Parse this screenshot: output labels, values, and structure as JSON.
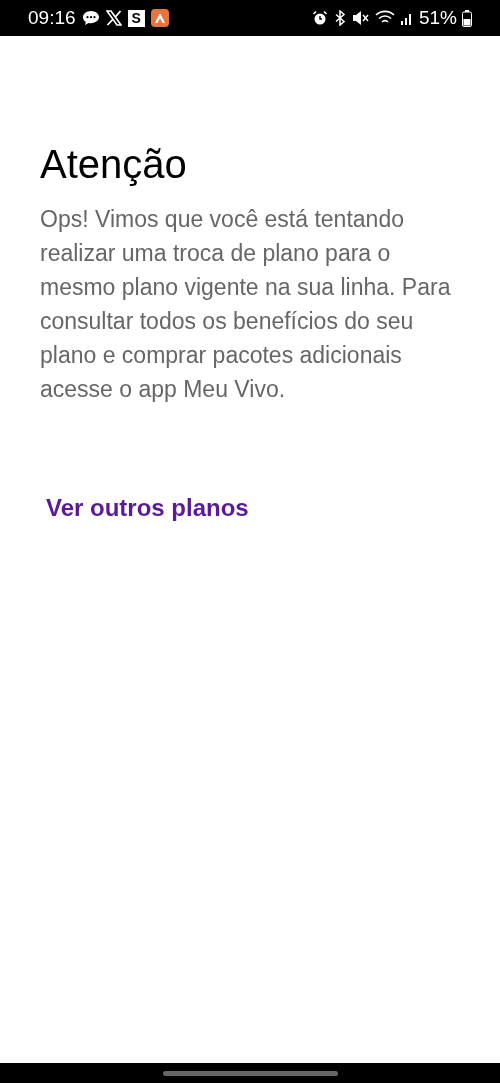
{
  "status_bar": {
    "time": "09:16",
    "app_badge": "S",
    "battery": "51%"
  },
  "title": "Atenção",
  "message": "Ops! Vimos que você está tentando realizar uma troca de plano para o mesmo plano vigente na sua linha. Para consultar todos os benefícios do seu plano e comprar pacotes adicionais acesse o app Meu Vivo.",
  "link": "Ver outros planos"
}
